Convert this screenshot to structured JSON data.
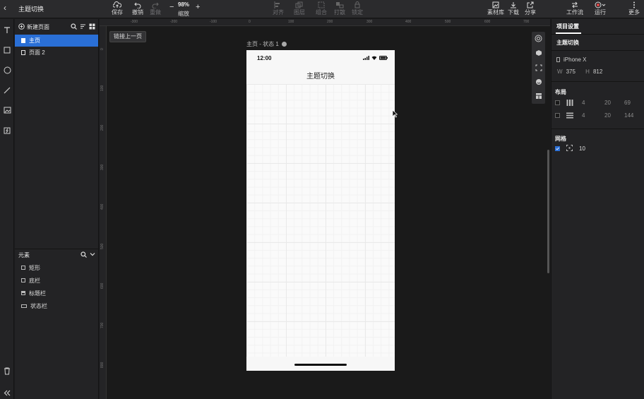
{
  "app": {
    "title": "主题切换"
  },
  "toolbar": {
    "save": "保存",
    "undo": "撤销",
    "redo": "重做",
    "zoom_value": "98%",
    "zoom_label": "缩放",
    "align": "对齐",
    "layer": "图层",
    "group": "组合",
    "ungroup": "打散",
    "lock": "锁定",
    "assets": "素材库",
    "download": "下载",
    "share": "分享",
    "workflow": "工作流",
    "run": "运行",
    "more": "更多"
  },
  "pages_panel": {
    "new_page": "新建页面",
    "pages": [
      {
        "label": "主页",
        "selected": true
      },
      {
        "label": "页面 2",
        "selected": false
      }
    ]
  },
  "elements_panel": {
    "title": "元素",
    "items": [
      {
        "label": "矩形"
      },
      {
        "label": "底栏"
      },
      {
        "label": "标题栏"
      },
      {
        "label": "状态栏"
      }
    ]
  },
  "canvas": {
    "link_prev": "链接上一页",
    "frame_label": "主页 - 状态 1",
    "ruler_top": [
      "-300",
      "-200",
      "-100",
      "0",
      "100",
      "200",
      "300",
      "400",
      "500",
      "600",
      "700"
    ],
    "ruler_left": [
      "0",
      "100",
      "200",
      "300",
      "400",
      "500",
      "600",
      "700",
      "800"
    ],
    "phone": {
      "time": "12:00",
      "nav_title": "主题切换"
    }
  },
  "right_panel": {
    "tab": "项目设置",
    "project_name": "主题切换",
    "device": "iPhone X",
    "w_label": "W",
    "w_value": "375",
    "h_label": "H",
    "h_value": "812",
    "layout_title": "布局",
    "layout_cols": {
      "count": "4",
      "gutter": "20",
      "margin": "69"
    },
    "layout_rows": {
      "count": "4",
      "gutter": "20",
      "margin": "144"
    },
    "grid_title": "网格",
    "grid_size": "10",
    "grid_enabled": true
  },
  "colors": {
    "accent": "#2a6fd6",
    "background": "#1c1c1e"
  }
}
